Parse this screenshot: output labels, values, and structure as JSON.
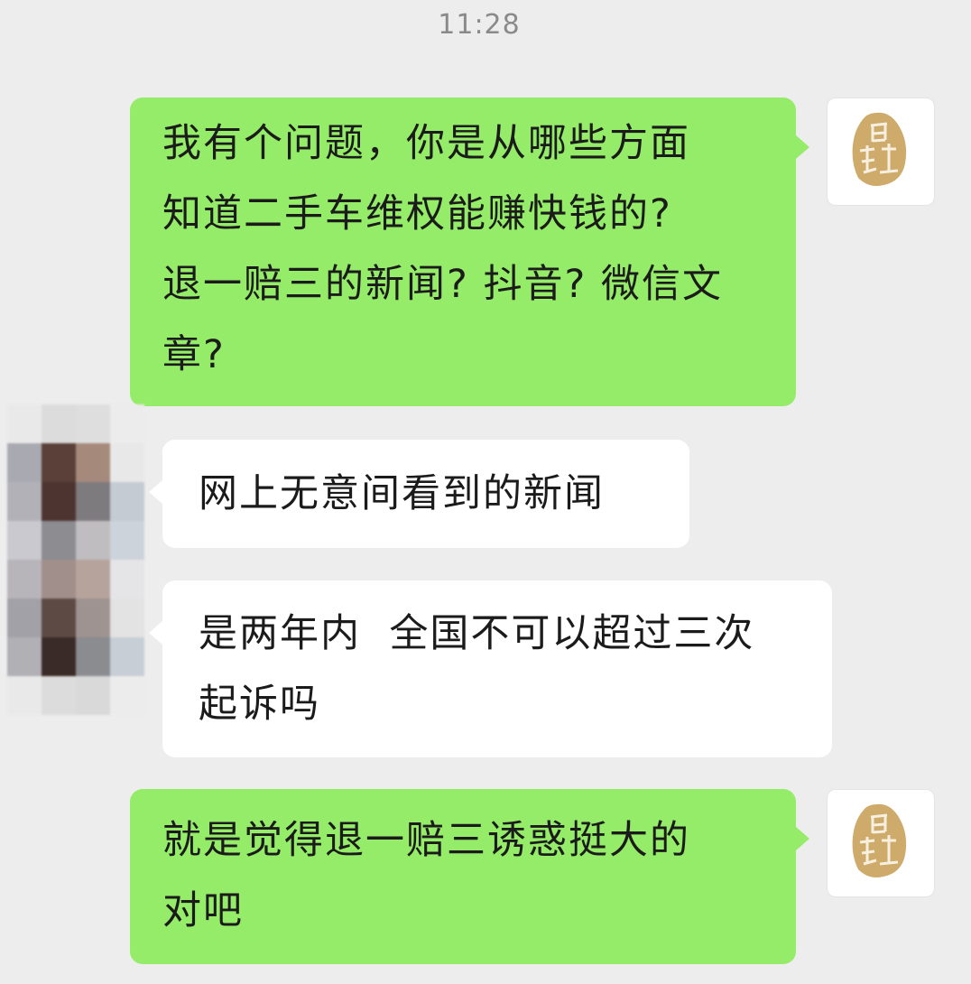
{
  "timestamp": "11:28",
  "self_avatar": {
    "icon": "seal-stamp-avatar",
    "glyphs": "白武士"
  },
  "contact_avatar": {
    "icon": "pixelated-avatar",
    "colors": [
      "#e9e9e9",
      "#dcdcdc",
      "#dedede",
      "#ececec",
      "#a9a9b2",
      "#5a4038",
      "#a58a7c",
      "#e8e8e8",
      "#b3b1b8",
      "#4d3430",
      "#7e7b7f",
      "#c4cbd3",
      "#c9c9cf",
      "#8c8c91",
      "#bfbdbf",
      "#cdd3db",
      "#b7b5ba",
      "#a18f8c",
      "#b6a39c",
      "#e5e5e7",
      "#a2a1a7",
      "#5d4a45",
      "#9e9390",
      "#e3e3e3",
      "#b0b0b5",
      "#3b2b28",
      "#8a8c90",
      "#c8ced6",
      "#e9e9ea",
      "#dcdcdc",
      "#d9d9d9",
      "#ececec"
    ]
  },
  "messages": [
    {
      "side": "sent",
      "text": "我有个问题，你是从哪些方面\n知道二手车维权能赚快钱的?\n退一赔三的新闻? 抖音? 微信文\n章?"
    },
    {
      "side": "received",
      "text": "网上无意间看到的新闻"
    },
    {
      "side": "received",
      "text": "是两年内  全国不可以超过三次\n起诉吗"
    },
    {
      "side": "sent",
      "text": "就是觉得退一赔三诱惑挺大的\n对吧"
    }
  ],
  "colors": {
    "background": "#ededed",
    "sent_bubble": "#95ec69",
    "received_bubble": "#ffffff",
    "text": "#1b1b1b",
    "timestamp": "#8a8a8a"
  }
}
